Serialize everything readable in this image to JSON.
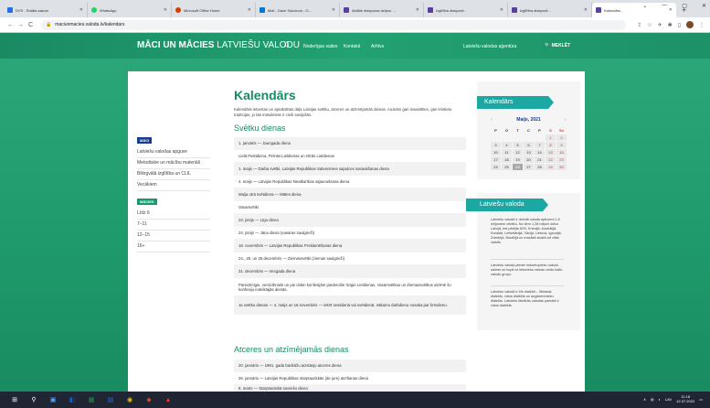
{
  "browser": {
    "tabs": [
      {
        "title": "DVS - Rotāla sakum",
        "color": "#1a73e8"
      },
      {
        "title": "WhatsApp",
        "color": "#25d366"
      },
      {
        "title": "Microsoft Office Home",
        "color": "#d83b01"
      },
      {
        "title": "Mail - Dace Sokolova - O...",
        "color": "#0078d4"
      },
      {
        "title": "Aktālie diasporas dzīpsu ...",
        "color": "#5b3fa0"
      },
      {
        "title": "Izglītība diasporā -",
        "color": "#5b3fa0"
      },
      {
        "title": "Izglītība diasporā -",
        "color": "#5b3fa0"
      },
      {
        "title": "Kalendārs -",
        "color": "#5b3fa0"
      }
    ],
    "new_tab": "+",
    "window_controls": [
      "⌄",
      "—",
      "▢",
      "✕"
    ],
    "url": "maciunmacies.valoda.lv/kalendars",
    "nav": {
      "back": "←",
      "forward": "→",
      "reload": "C"
    }
  },
  "header": {
    "logo_bold": "MĀCI UN MĀCIES",
    "logo_thin": "LATVIEŠU VALODU",
    "nav": [
      "Noderīgas saites",
      "Kontakti",
      "Arhīvs",
      "Latviešu valodas aģentūra"
    ],
    "search_label": "MEKLĒT"
  },
  "sidebar": {
    "group1_title": "MĀCI",
    "group1_items": [
      "Latviešu valodas apguve",
      "Metodiskie un mācību materiāli",
      "Bilingvālā izglītība un CLIL",
      "Vecākiem"
    ],
    "group2_title": "MĀCIES",
    "group2_items": [
      "Līdz 6",
      "7–11",
      "12–15",
      "16+"
    ]
  },
  "main": {
    "title": "Kalendārs",
    "intro": "Kalendārā ietvertas un aprakstītas daļa Latvijas svētku, atceres un atzīmējamās dienas. Aicinām gan iesaistīties, gan kristietu tradīcijas, jo tās mūsdienās ir cieši savijušās.",
    "holidays_title": "Svētku dienas",
    "holidays": [
      "1. janvāris — Jaungada diena",
      "Lielā Piektdiena, Pirmās Lieldienas un Otrās Lieldienas",
      "1. maijs — Darba svētki, Latvijas Republikas Satversmes sapulces sasaukšanas diena",
      "4. maijs — Latvijas Republikas Neatkarības atjaunošanas diena",
      "Maija otrā svētdiena — Mātes diena",
      "Vasarsvētki",
      "23. jūnijs — Līgo diena",
      "24. jūnijs — Jāņu diena (vasaras saulgrieži)",
      "18. novembris — Latvijas Republikas Proklamēšanas diena",
      "24., 25. un 26.decembris — Ziemassvētki (ziemas saulgrieži)",
      "31. decembris — Vecgada diena",
      "Pareizticīgie, vecticībnieki un pie citām konfesijām piederošie ticīgie Lieldienas, Vasarsvētkus un Ziemassvētkus atzīmē šo konfesiju noteiktajās dienās.",
      "Ja svētku dienas — 4. maijs un 18.novembris — iekrīt sestdienā vai svētdienā, nākamo darbdienu nosaka par brīvdienu."
    ],
    "events_title": "Atceres un atzīmējamās dienas",
    "events": [
      "20. janvāris — 1991. gada barikāžu aizstāvju atceres diena",
      "26. janvāris — Latvijas Republikas starptautiskās (de jure) atzīšanas diena",
      "8. marts — Starptautiskā sieviešu diena"
    ]
  },
  "calendar": {
    "title": "Kalendārs",
    "month": "Maijs, 2021",
    "prev": "‹",
    "next": "›",
    "weekdays": [
      "P",
      "O",
      "T",
      "C",
      "P",
      "S",
      "Sv"
    ],
    "weeks": [
      [
        "",
        "",
        "",
        "",
        "",
        "1",
        "2"
      ],
      [
        "3",
        "4",
        "5",
        "6",
        "7",
        "8",
        "9"
      ],
      [
        "10",
        "11",
        "12",
        "13",
        "14",
        "15",
        "16"
      ],
      [
        "17",
        "18",
        "19",
        "20",
        "21",
        "22",
        "23"
      ],
      [
        "24",
        "25",
        "26",
        "27",
        "28",
        "29",
        "30"
      ]
    ]
  },
  "language_widget": {
    "title": "Latviešu valoda",
    "paragraphs": [
      "Latviešu valodā ir dzimtā valoda aptuveni 1,5 miljoniem cilvēku. No tiem 1,38 miljoni dzīvo Latvijā, bet pārējie ASV, Krievijā, Austrālijā, Kanādā, Lielbritānijā, Vācijā, Lietuvā, Igaunijā, Zviedrijā, Brazīlijā un mazākā skaitā arī citās valstīs.",
      "Latviešu valoda pieder indoeiropiešu valodu saimei un kopā ar lietuviešu valodu veido baltu valodu grupu.",
      "Latviešu valodā ir trīs dialekti – lībiskais dialekts, vidus dialekts un augšzemnieku dialekts. Latviešu literārās valodas pamatā ir vidus dialekts."
    ]
  },
  "taskbar": {
    "lang": "LAV",
    "time": "11:18",
    "date": "12.07.2022"
  },
  "colors": {
    "brand_green": "#1a8a63",
    "accent_teal": "#1ba7a2",
    "nav_blue": "#1a3c8f",
    "weekend_red": "#d6332c"
  }
}
